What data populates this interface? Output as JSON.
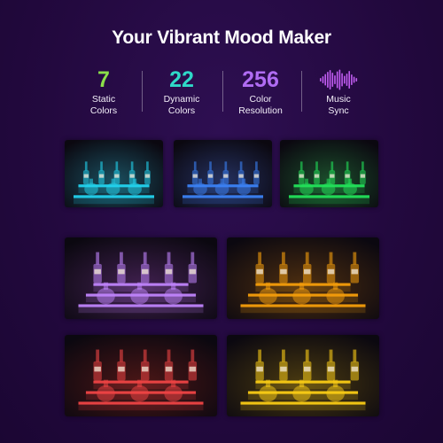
{
  "title": "Your Vibrant Mood Maker",
  "stats": [
    {
      "number": "7",
      "label_line1": "Static",
      "label_line2": "Colors",
      "color": "#8be04a"
    },
    {
      "number": "22",
      "label_line1": "Dynamic",
      "label_line2": "Colors",
      "color": "#2fd9c8"
    },
    {
      "number": "256",
      "label_line1": "Color",
      "label_line2": "Resolution",
      "color": "#b06cf3"
    },
    {
      "icon": "sound-wave-icon",
      "label_line1": "Music",
      "label_line2": "Sync",
      "color": "#c05cf0"
    }
  ],
  "panels": [
    {
      "name": "panel-cyan-shelf",
      "glow": "#22d3ee",
      "tint": "#1a4e5e",
      "tiers": 2
    },
    {
      "name": "panel-blue-shelf",
      "glow": "#3b82f6",
      "tint": "#24305e",
      "tiers": 2
    },
    {
      "name": "panel-green-shelf",
      "glow": "#22e35a",
      "tint": "#1b4d2b",
      "tiers": 2
    },
    {
      "name": "panel-purple-shelf",
      "glow": "#c084fc",
      "tint": "#40204f",
      "tiers": 3
    },
    {
      "name": "panel-amber-shelf",
      "glow": "#f59e0b",
      "tint": "#4d2e10",
      "tiers": 3
    },
    {
      "name": "panel-red-shelf",
      "glow": "#ef4444",
      "tint": "#4b1616",
      "tiers": 3
    },
    {
      "name": "panel-yellow-shelf",
      "glow": "#facc15",
      "tint": "#4a3a10",
      "tiers": 3
    }
  ]
}
